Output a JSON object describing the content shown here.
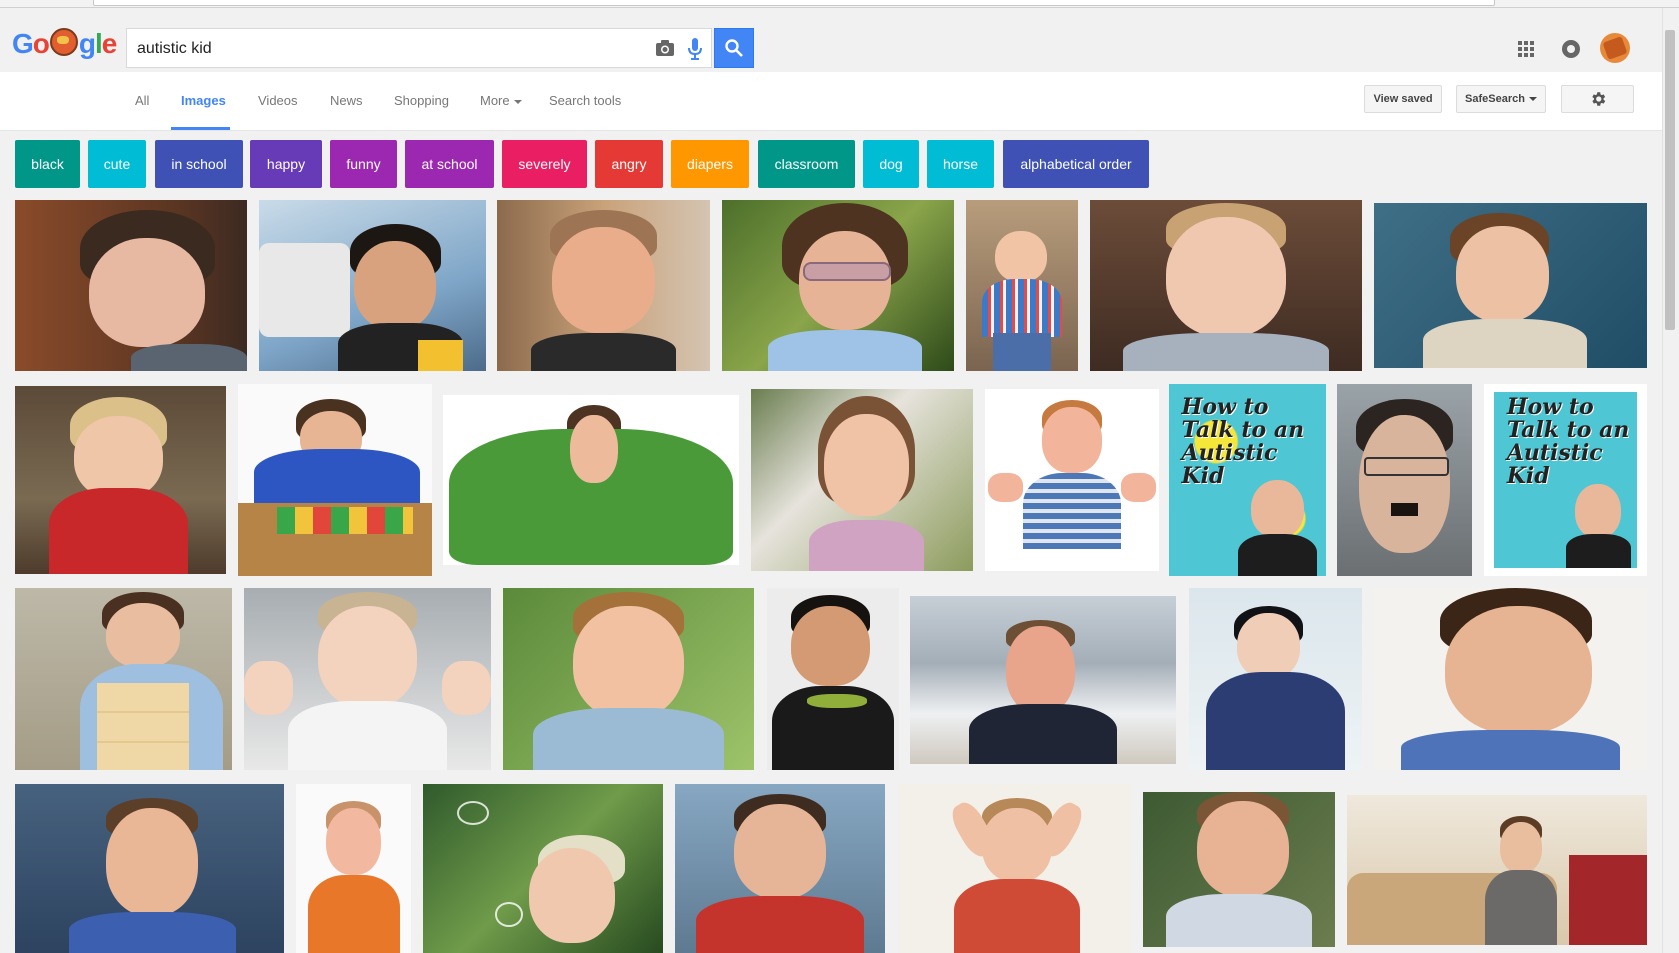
{
  "search": {
    "query": "autistic kid"
  },
  "logo": {
    "parts": [
      "Go",
      "gle"
    ]
  },
  "tabs": [
    {
      "label": "All"
    },
    {
      "label": "Images"
    },
    {
      "label": "Videos"
    },
    {
      "label": "News"
    },
    {
      "label": "Shopping"
    },
    {
      "label": "More"
    },
    {
      "label": "Search tools"
    }
  ],
  "tools": {
    "view_saved": "View saved",
    "safesearch": "SafeSearch"
  },
  "chips": [
    {
      "label": "black",
      "color": "#009688"
    },
    {
      "label": "cute",
      "color": "#00bcd4"
    },
    {
      "label": "in school",
      "color": "#3f51b5"
    },
    {
      "label": "happy",
      "color": "#673ab7"
    },
    {
      "label": "funny",
      "color": "#9c27b0"
    },
    {
      "label": "at school",
      "color": "#9c27b0"
    },
    {
      "label": "severely",
      "color": "#e91e63"
    },
    {
      "label": "angry",
      "color": "#e53935"
    },
    {
      "label": "diapers",
      "color": "#ff9800"
    },
    {
      "label": "classroom",
      "color": "#009688"
    },
    {
      "label": "dog",
      "color": "#00bcd4"
    },
    {
      "label": "horse",
      "color": "#00bcd4"
    },
    {
      "label": "alphabetical order",
      "color": "#3f51b5"
    }
  ],
  "books": [
    {
      "title": "How to Talk to an Autistic Kid"
    },
    {
      "title": "How to Talk to an Autistic Kid"
    }
  ],
  "colors": {
    "accent": "#4285f4",
    "search_button": "#4285f4"
  }
}
